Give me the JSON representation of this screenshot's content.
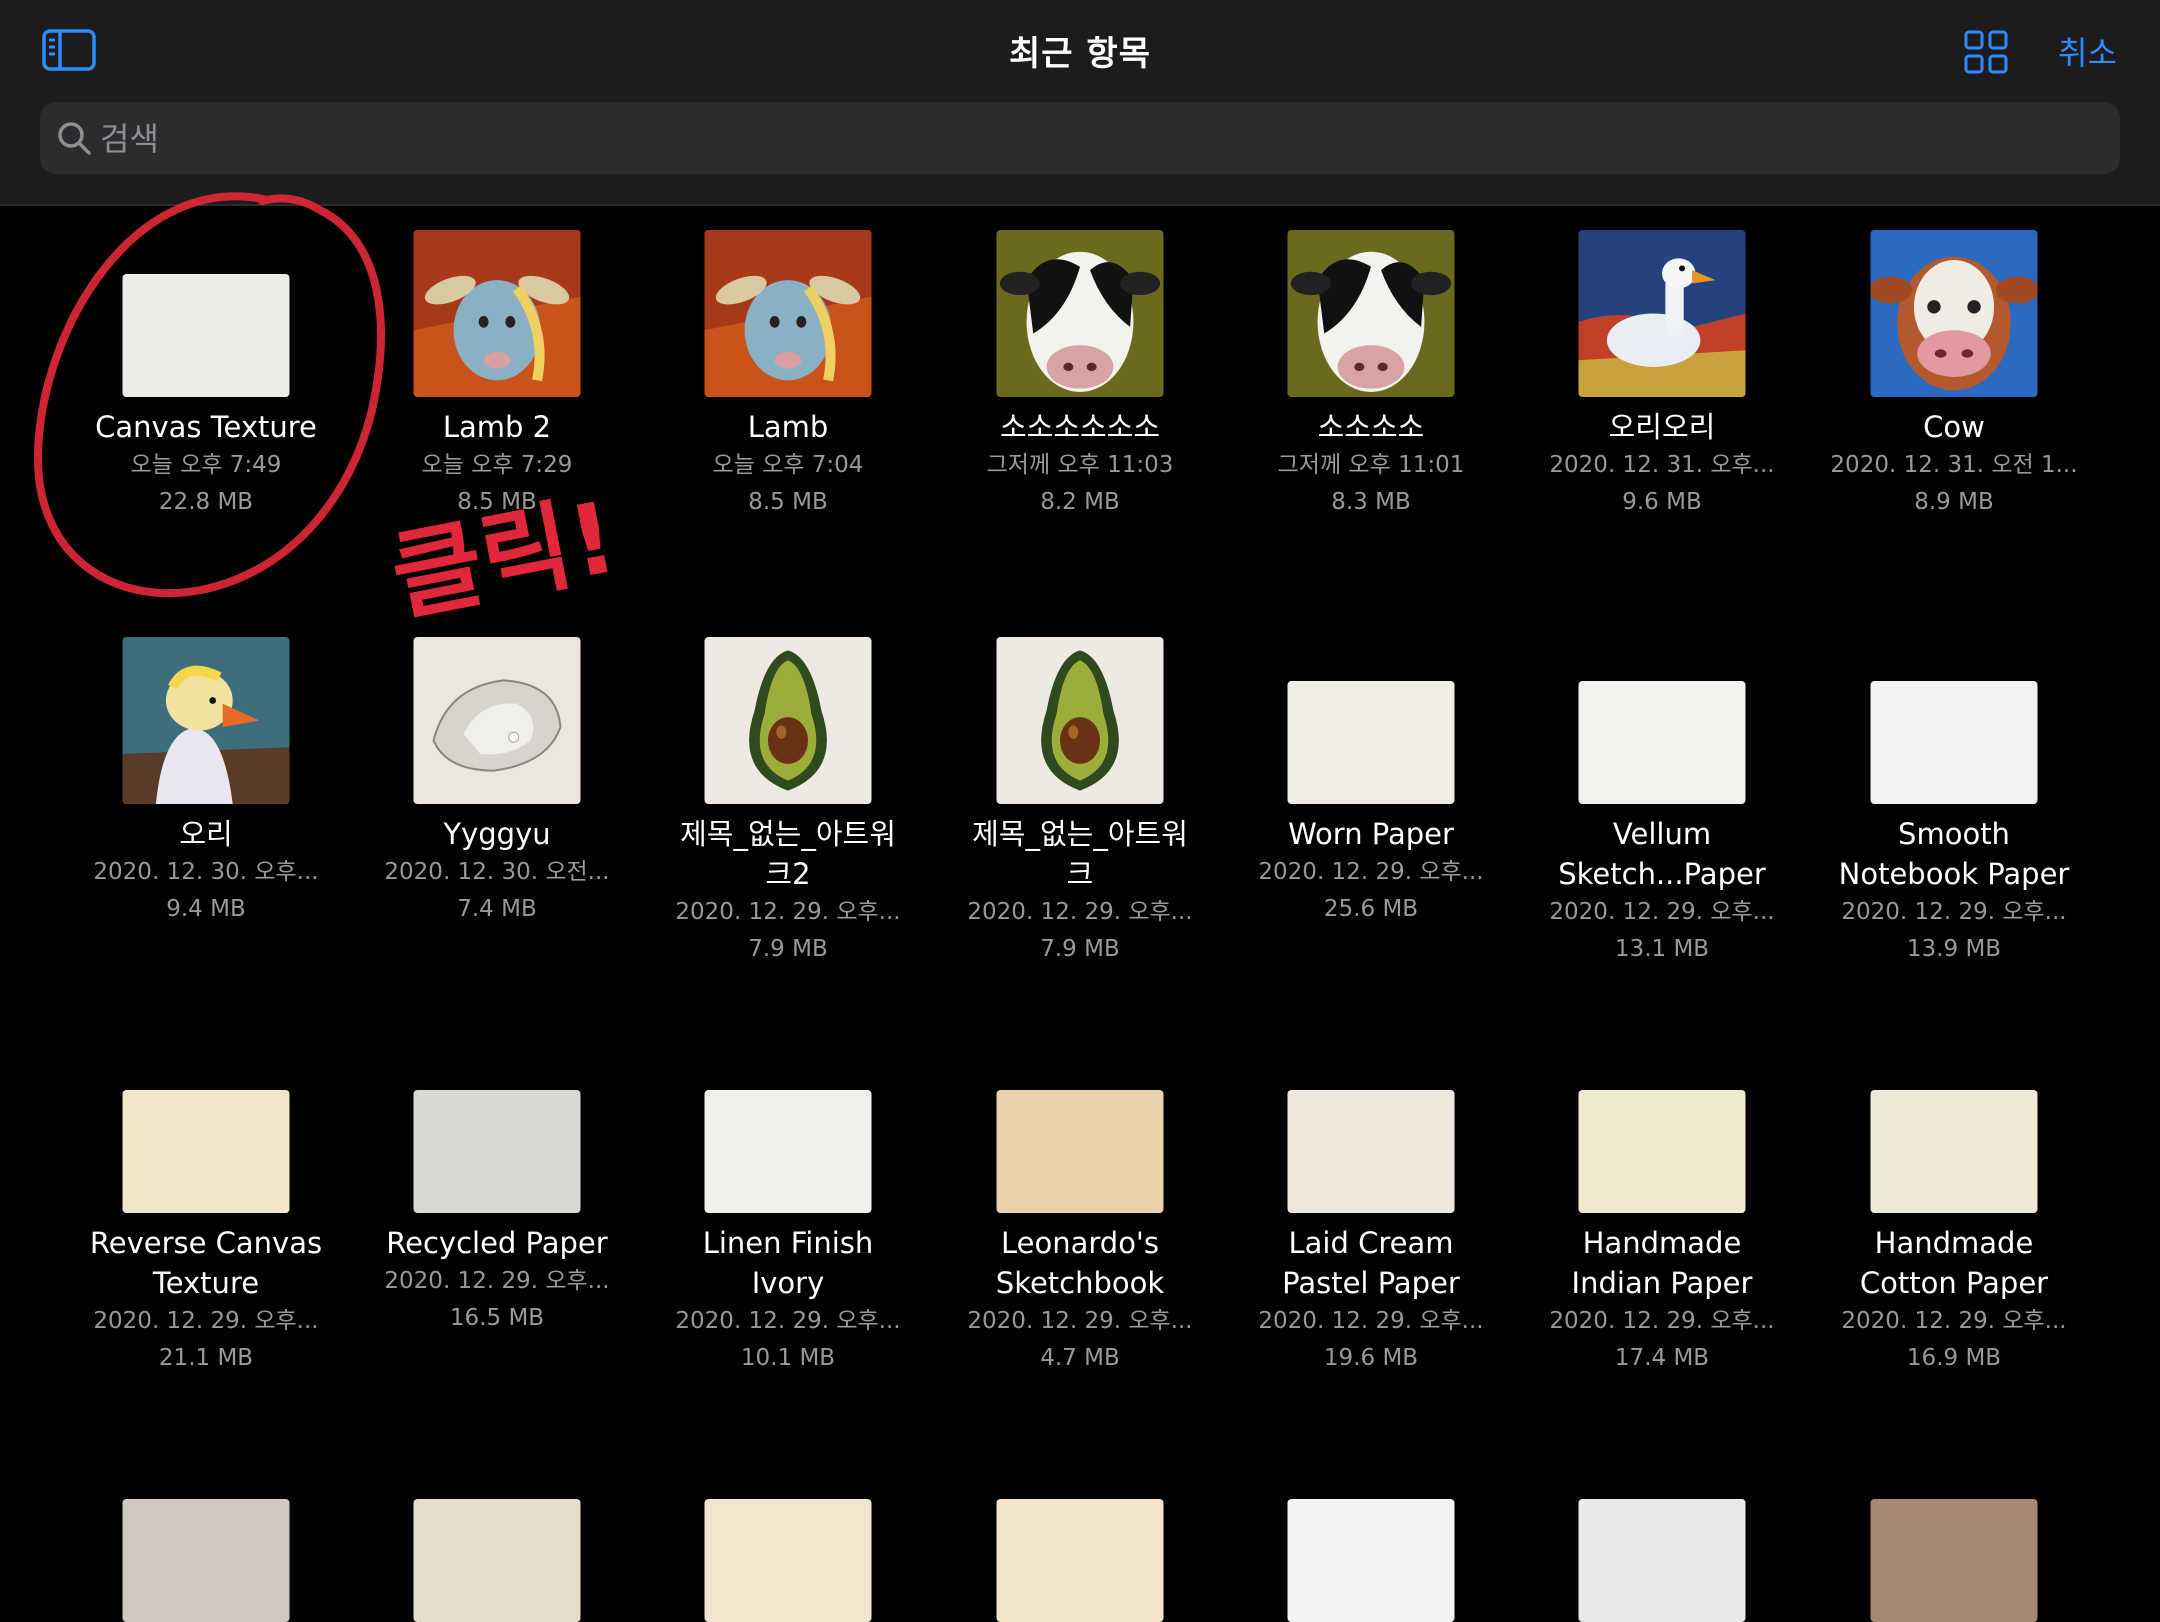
{
  "header": {
    "title": "최근 항목",
    "cancel_label": "취소",
    "search_placeholder": "검색"
  },
  "accent_color": "#2e8cff",
  "annotation": {
    "text": "클릭!",
    "color": "#e0283a"
  },
  "items": [
    {
      "name": "Canvas Texture",
      "date": "오늘 오후 7:49",
      "size": "22.8 MB",
      "thumb": "paper",
      "tone": "#eeece6"
    },
    {
      "name": "Lamb 2",
      "date": "오늘 오후 7:29",
      "size": "8.5 MB",
      "thumb": "lamb",
      "tone": "#c8541c"
    },
    {
      "name": "Lamb",
      "date": "오늘 오후 7:04",
      "size": "8.5 MB",
      "thumb": "lamb",
      "tone": "#c8541c"
    },
    {
      "name": "소소소소소소",
      "date": "그저께 오후 11:03",
      "size": "8.2 MB",
      "thumb": "cow-bw",
      "tone": "#6a6a1e"
    },
    {
      "name": "소소소소",
      "date": "그저께 오후 11:01",
      "size": "8.3 MB",
      "thumb": "cow-bw",
      "tone": "#6a6a1e"
    },
    {
      "name": "오리오리",
      "date": "2020. 12. 31. 오후...",
      "size": "9.6 MB",
      "thumb": "duck-blue",
      "tone": "#23427e"
    },
    {
      "name": "Cow",
      "date": "2020. 12. 31. 오전 1...",
      "size": "8.9 MB",
      "thumb": "cow-brown",
      "tone": "#2a6ac0"
    },
    {
      "name": "오리",
      "date": "2020. 12. 30. 오후...",
      "size": "9.4 MB",
      "thumb": "duck-teal",
      "tone": "#3d6e7c"
    },
    {
      "name": "Yyggyu",
      "date": "2020. 12. 30. 오전...",
      "size": "7.4 MB",
      "thumb": "oyster",
      "tone": "#ebe7df"
    },
    {
      "name": "제목_없는_아트워\n크2",
      "date": "2020. 12. 29. 오후...",
      "size": "7.9 MB",
      "thumb": "avocado",
      "tone": "#eeeae2"
    },
    {
      "name": "제목_없는_아트워\n크",
      "date": "2020. 12. 29. 오후...",
      "size": "7.9 MB",
      "thumb": "avocado",
      "tone": "#eeeae2"
    },
    {
      "name": "Worn Paper",
      "date": "2020. 12. 29. 오후...",
      "size": "25.6 MB",
      "thumb": "paper",
      "tone": "#f1ede6"
    },
    {
      "name": "Vellum\nSketch...Paper",
      "date": "2020. 12. 29. 오후...",
      "size": "13.1 MB",
      "thumb": "paper",
      "tone": "#f4f2ee"
    },
    {
      "name": "Smooth\nNotebook Paper",
      "date": "2020. 12. 29. 오후...",
      "size": "13.9 MB",
      "thumb": "paper",
      "tone": "#f3f3f1"
    },
    {
      "name": "Reverse Canvas\nTexture",
      "date": "2020. 12. 29. 오후...",
      "size": "21.1 MB",
      "thumb": "paper",
      "tone": "#f2e6c9"
    },
    {
      "name": "Recycled Paper",
      "date": "2020. 12. 29. 오후...",
      "size": "16.5 MB",
      "thumb": "paper",
      "tone": "#d9d8d4"
    },
    {
      "name": "Linen Finish\nIvory",
      "date": "2020. 12. 29. 오후...",
      "size": "10.1 MB",
      "thumb": "paper",
      "tone": "#f2f0ea"
    },
    {
      "name": "Leonardo's\nSketchbook",
      "date": "2020. 12. 29. 오후...",
      "size": "4.7 MB",
      "thumb": "paper",
      "tone": "#ead2ad"
    },
    {
      "name": "Laid Cream\nPastel Paper",
      "date": "2020. 12. 29. 오후...",
      "size": "19.6 MB",
      "thumb": "paper",
      "tone": "#f1e8dc"
    },
    {
      "name": "Handmade\nIndian Paper",
      "date": "2020. 12. 29. 오후...",
      "size": "17.4 MB",
      "thumb": "paper",
      "tone": "#f2e8cf"
    },
    {
      "name": "Handmade\nCotton Paper",
      "date": "2020. 12. 29. 오후...",
      "size": "16.9 MB",
      "thumb": "paper",
      "tone": "#f1e9d8"
    },
    {
      "name": "",
      "date": "",
      "size": "",
      "thumb": "paper",
      "tone": "#cfc9c2"
    },
    {
      "name": "",
      "date": "",
      "size": "",
      "thumb": "paper",
      "tone": "#e8dccd"
    },
    {
      "name": "",
      "date": "",
      "size": "",
      "thumb": "paper",
      "tone": "#f3e6cf"
    },
    {
      "name": "",
      "date": "",
      "size": "",
      "thumb": "paper",
      "tone": "#f3e5c8"
    },
    {
      "name": "",
      "date": "",
      "size": "",
      "thumb": "paper",
      "tone": "#f4f4f3"
    },
    {
      "name": "",
      "date": "",
      "size": "",
      "thumb": "paper",
      "tone": "#e8e8ea"
    },
    {
      "name": "",
      "date": "",
      "size": "",
      "thumb": "paper",
      "tone": "#a88a72"
    }
  ]
}
